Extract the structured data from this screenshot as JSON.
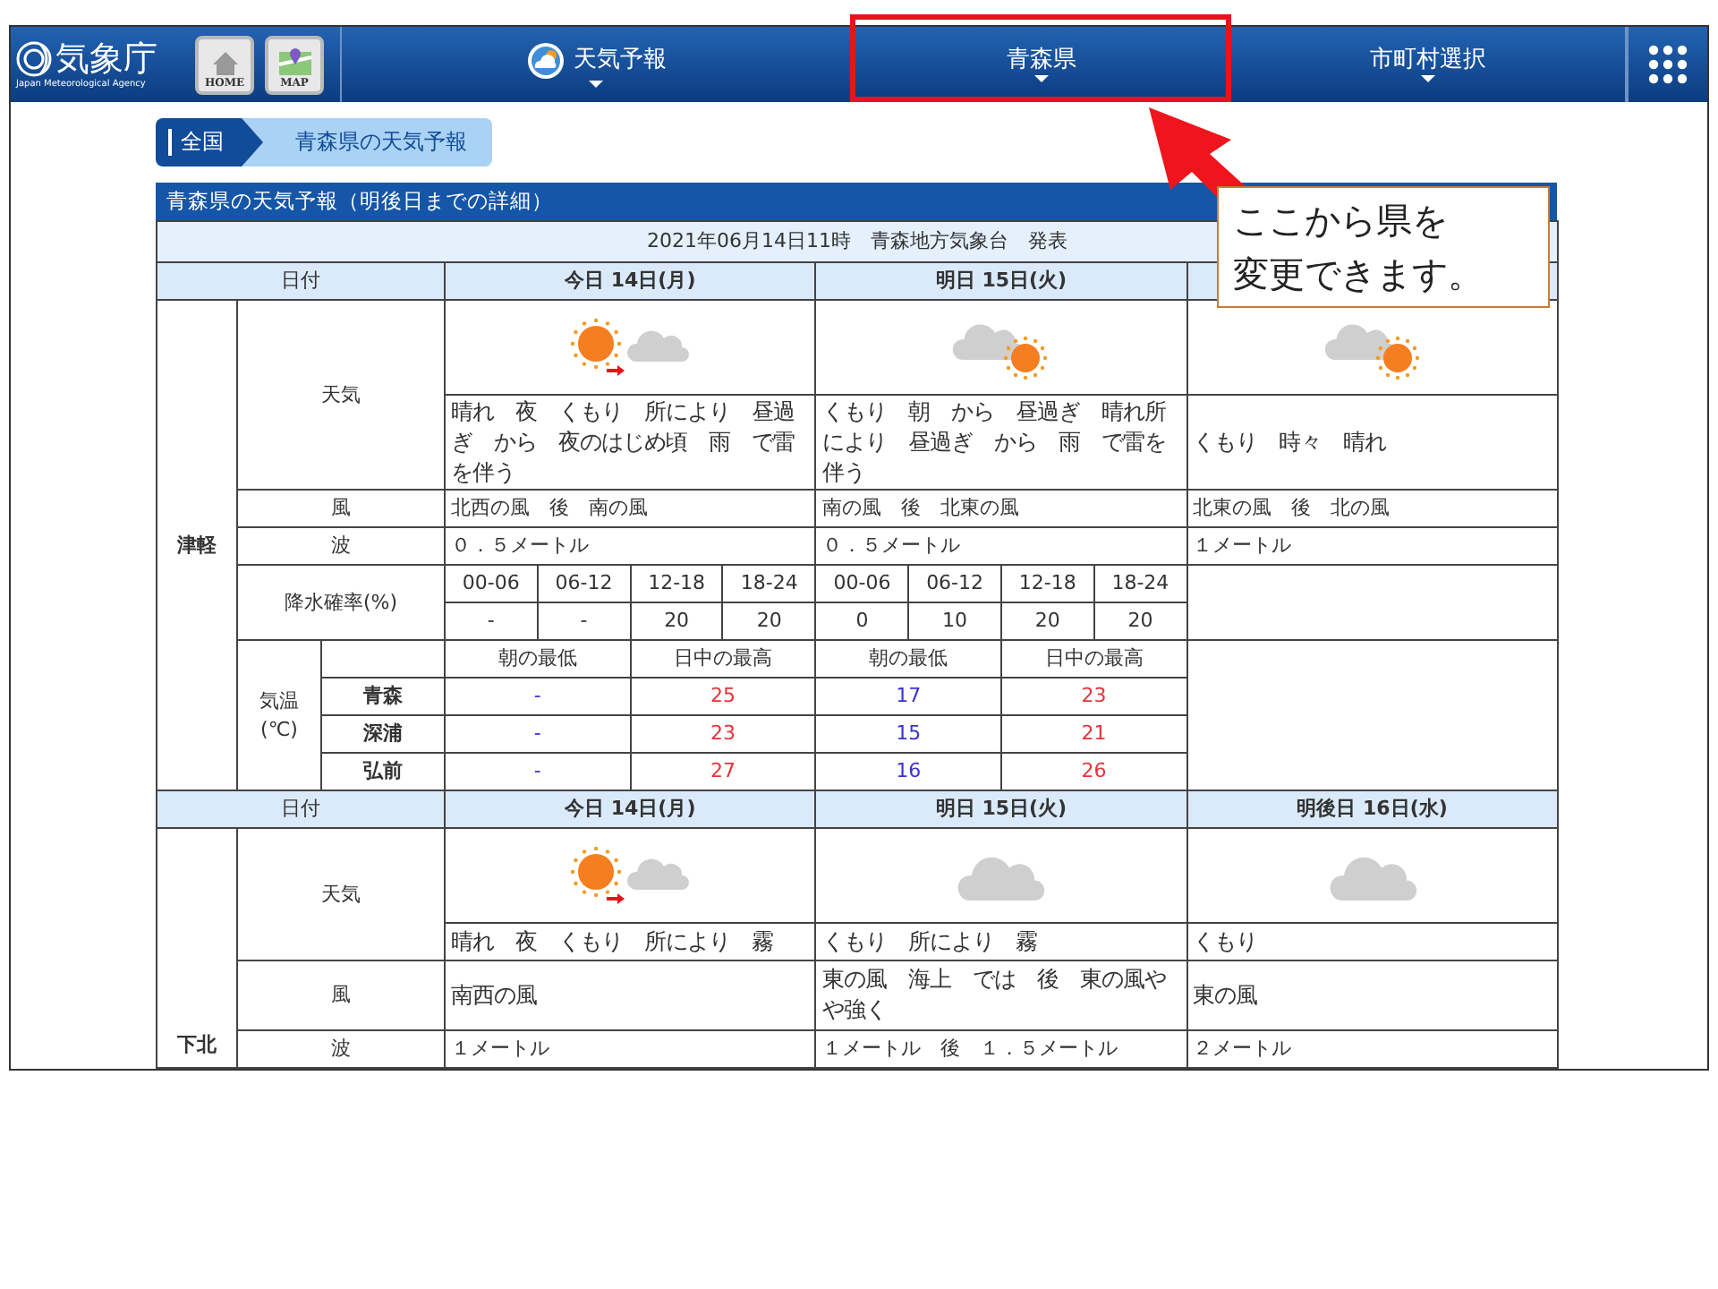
{
  "header": {
    "logo_text": "気象庁",
    "logo_sub": "Japan Meteorological Agency",
    "home_label": "HOME",
    "map_label": "MAP",
    "menus": [
      {
        "label": "天気予報",
        "kind": "forecast",
        "highlighted": false
      },
      {
        "label": "青森県",
        "kind": "plain",
        "highlighted": true
      },
      {
        "label": "市町村選択",
        "kind": "plain",
        "highlighted": false
      }
    ]
  },
  "breadcrumb": [
    {
      "label": "全国"
    },
    {
      "label": "青森県の天気予報"
    }
  ],
  "forecast": {
    "title": "青森県の天気予報（明後日までの詳細）",
    "issued": "2021年06月14日11時　青森地方気象台　発表",
    "areas": [
      {
        "name": "津軽",
        "date_label": "日付",
        "weather_label": "天気",
        "wind_label": "風",
        "wave_label": "波",
        "pop_label": "降水確率(%)",
        "temperature": {
          "label": "気温",
          "unit": "(℃)",
          "cities": [
            "青森",
            "深浦",
            "弘前"
          ]
        },
        "days": [
          {
            "date": "今日 14日(月)",
            "kind": "sunny_later_cloudy",
            "weather_text": "晴れ　夜　くもり　所により　昼過ぎ　から　夜のはじめ頃　雨　で雷を伴う",
            "wind": "北西の風　後　南の風",
            "wave": "０．５メートル",
            "pop_times": [
              "00-06",
              "06-12",
              "12-18",
              "18-24"
            ],
            "pop_values": [
              "-",
              "-",
              "20",
              "20"
            ],
            "temp_headers": [
              "朝の最低",
              "日中の最高"
            ],
            "temps": [
              [
                "-",
                "25"
              ],
              [
                "-",
                "23"
              ],
              [
                "-",
                "27"
              ]
            ]
          },
          {
            "date": "明日 15日(火)",
            "kind": "cloudy_sometimes_sunny",
            "weather_text": "くもり　朝　から　昼過ぎ　晴れ所により　昼過ぎ　から　雨　で雷を伴う",
            "wind": "南の風　後　北東の風",
            "wave": "０．５メートル",
            "pop_times": [
              "00-06",
              "06-12",
              "12-18",
              "18-24"
            ],
            "pop_values": [
              "0",
              "10",
              "20",
              "20"
            ],
            "temp_headers": [
              "朝の最低",
              "日中の最高"
            ],
            "temps": [
              [
                "17",
                "23"
              ],
              [
                "15",
                "21"
              ],
              [
                "16",
                "26"
              ]
            ]
          },
          {
            "kind": "cloudy_sometimes_sunny",
            "weather_text": "くもり　時々　晴れ",
            "wind": "北東の風　後　北の風",
            "wave": "１メートル"
          }
        ]
      },
      {
        "name": "下北",
        "date_label": "日付",
        "weather_label": "天気",
        "wind_label": "風",
        "wave_label": "波",
        "days": [
          {
            "date": "今日 14日(月)",
            "kind": "sunny_later_cloudy",
            "weather_text": "晴れ　夜　くもり　所により　霧",
            "wind": "南西の風",
            "wave": "１メートル"
          },
          {
            "date": "明日 15日(火)",
            "kind": "cloudy",
            "weather_text": "くもり　所により　霧",
            "wind": "東の風　海上　では　後　東の風やや強く",
            "wave": "１メートル　後　１．５メートル"
          },
          {
            "date": "明後日 16日(水)",
            "kind": "cloudy",
            "weather_text": "くもり",
            "wind": "東の風",
            "wave": "２メートル"
          }
        ]
      }
    ]
  },
  "callout": {
    "lines": [
      "ここから県を",
      "変更できます。"
    ]
  }
}
